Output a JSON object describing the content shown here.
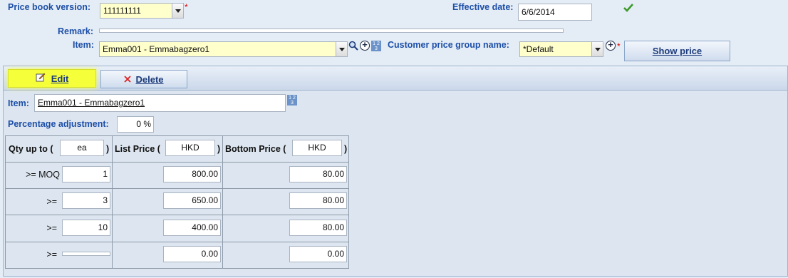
{
  "header": {
    "price_book_version_label": "Price book version:",
    "price_book_version_value": "111111111",
    "effective_date_label": "Effective date:",
    "effective_date_value": "6/6/2014",
    "remark_label": "Remark:",
    "remark_value": "",
    "item_label": "Item:",
    "item_value": "Emma001 - Emmabagzero1",
    "customer_group_label": "Customer price group name:",
    "customer_group_value": "*Default",
    "show_price_label": "Show price",
    "required_mark": "*",
    "num_icon_text": "1 2 3"
  },
  "toolbar": {
    "edit_label": "Edit",
    "delete_label": "Delete"
  },
  "detail": {
    "item_label": "Item:",
    "item_value": "Emma001 - Emmabagzero1",
    "pct_label": "Percentage adjustment:",
    "pct_value": "0 %"
  },
  "price_table": {
    "qty_header": "Qty up to (",
    "qty_unit": "ea",
    "list_header": "List Price (",
    "list_currency": "HKD",
    "bottom_header": "Bottom Price (",
    "bottom_currency": "HKD",
    "close_paren": ")",
    "rows": [
      {
        "op": ">= MOQ",
        "qty": "1",
        "list": "800.00",
        "bottom": "80.00"
      },
      {
        "op": ">=",
        "qty": "3",
        "list": "650.00",
        "bottom": "80.00"
      },
      {
        "op": ">=",
        "qty": "10",
        "list": "400.00",
        "bottom": "80.00"
      },
      {
        "op": ">=",
        "qty": "",
        "list": "0.00",
        "bottom": "0.00"
      }
    ]
  },
  "colors": {
    "label_blue": "#1d4fa8",
    "required_red": "#dd0000",
    "highlight": "#f5ff3a",
    "background": "#e4ecf5"
  }
}
